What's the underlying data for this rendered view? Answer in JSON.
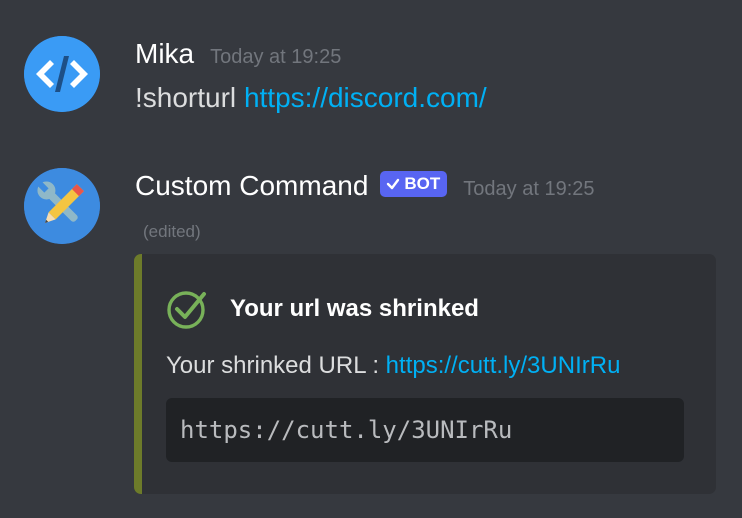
{
  "messages": [
    {
      "author": "Mika",
      "timestamp": "Today at 19:25",
      "command": "!shorturl",
      "link": "https://discord.com/"
    },
    {
      "author": "Custom Command",
      "bot_tag": "BOT",
      "timestamp": "Today at 19:25",
      "edited": "(edited)",
      "embed": {
        "title": "Your url was shrinked",
        "description_prefix": "Your shrinked URL : ",
        "description_link": "https://cutt.ly/3UNIrRu",
        "code": "https://cutt.ly/3UNIrRu",
        "accent_color": "#6d7b2a"
      }
    }
  ],
  "colors": {
    "background": "#36393f",
    "link": "#00b0f4",
    "bot_tag": "#5865f2"
  },
  "icons": {
    "avatar_1": "code-brackets-icon",
    "avatar_2": "tools-icon",
    "check": "check-circle-icon",
    "bot_check": "checkmark-icon"
  }
}
